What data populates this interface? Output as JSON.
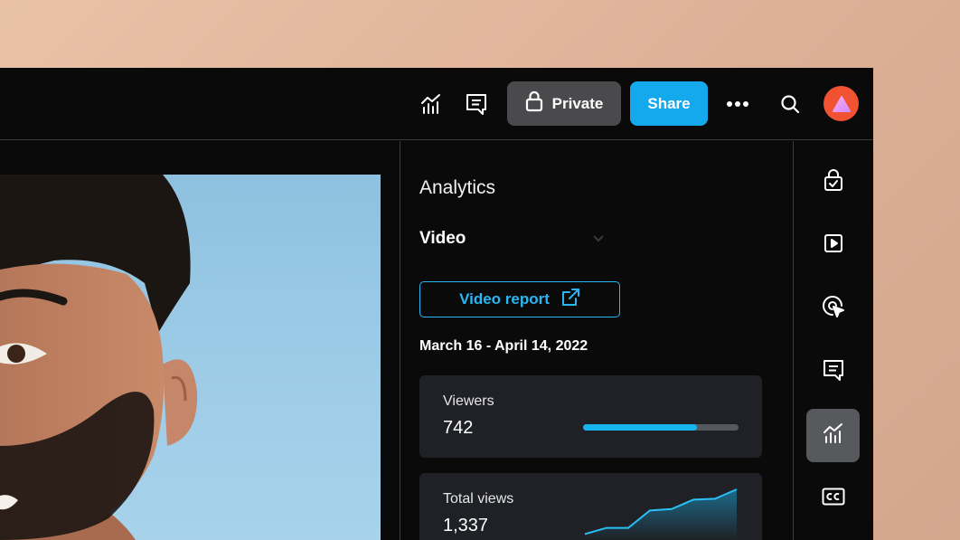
{
  "topbar": {
    "analytics_icon": "analytics-icon",
    "comments_icon": "comment-icon",
    "private_label": "Private",
    "share_label": "Share",
    "more_icon": "more-icon",
    "search_icon": "search-icon",
    "avatar_icon": "avatar"
  },
  "panel": {
    "title": "Analytics",
    "section": "Video",
    "report_button": "Video report",
    "date_range": "March 16 - April 14, 2022",
    "cards": [
      {
        "label": "Viewers",
        "value": "742",
        "progress": 0.73
      },
      {
        "label": "Total views",
        "value": "1,337",
        "sparkline": [
          0.05,
          0.18,
          0.18,
          0.55,
          0.58,
          0.78,
          0.8,
          1.0
        ]
      }
    ]
  },
  "rail": {
    "items": [
      {
        "name": "lock-check-icon",
        "active": false
      },
      {
        "name": "play-icon",
        "active": false
      },
      {
        "name": "cursor-click-icon",
        "active": false
      },
      {
        "name": "comment-icon",
        "active": false
      },
      {
        "name": "analytics-icon",
        "active": true
      },
      {
        "name": "closed-captions-icon",
        "active": false
      }
    ]
  },
  "colors": {
    "accent": "#14a9ec",
    "avatar": "#f05232",
    "background": "#0a0a0b"
  }
}
